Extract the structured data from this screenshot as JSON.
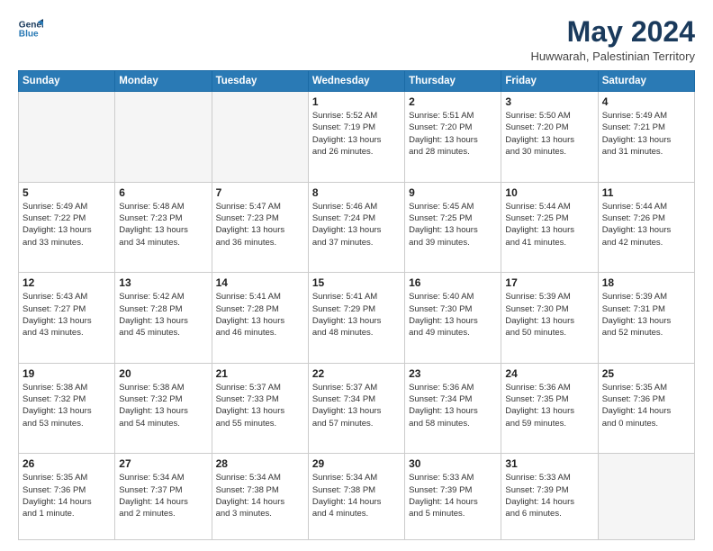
{
  "header": {
    "logo_line1": "General",
    "logo_line2": "Blue",
    "title": "May 2024",
    "subtitle": "Huwwarah, Palestinian Territory"
  },
  "weekdays": [
    "Sunday",
    "Monday",
    "Tuesday",
    "Wednesday",
    "Thursday",
    "Friday",
    "Saturday"
  ],
  "weeks": [
    [
      {
        "day": "",
        "info": ""
      },
      {
        "day": "",
        "info": ""
      },
      {
        "day": "",
        "info": ""
      },
      {
        "day": "1",
        "info": "Sunrise: 5:52 AM\nSunset: 7:19 PM\nDaylight: 13 hours\nand 26 minutes."
      },
      {
        "day": "2",
        "info": "Sunrise: 5:51 AM\nSunset: 7:20 PM\nDaylight: 13 hours\nand 28 minutes."
      },
      {
        "day": "3",
        "info": "Sunrise: 5:50 AM\nSunset: 7:20 PM\nDaylight: 13 hours\nand 30 minutes."
      },
      {
        "day": "4",
        "info": "Sunrise: 5:49 AM\nSunset: 7:21 PM\nDaylight: 13 hours\nand 31 minutes."
      }
    ],
    [
      {
        "day": "5",
        "info": "Sunrise: 5:49 AM\nSunset: 7:22 PM\nDaylight: 13 hours\nand 33 minutes."
      },
      {
        "day": "6",
        "info": "Sunrise: 5:48 AM\nSunset: 7:23 PM\nDaylight: 13 hours\nand 34 minutes."
      },
      {
        "day": "7",
        "info": "Sunrise: 5:47 AM\nSunset: 7:23 PM\nDaylight: 13 hours\nand 36 minutes."
      },
      {
        "day": "8",
        "info": "Sunrise: 5:46 AM\nSunset: 7:24 PM\nDaylight: 13 hours\nand 37 minutes."
      },
      {
        "day": "9",
        "info": "Sunrise: 5:45 AM\nSunset: 7:25 PM\nDaylight: 13 hours\nand 39 minutes."
      },
      {
        "day": "10",
        "info": "Sunrise: 5:44 AM\nSunset: 7:25 PM\nDaylight: 13 hours\nand 41 minutes."
      },
      {
        "day": "11",
        "info": "Sunrise: 5:44 AM\nSunset: 7:26 PM\nDaylight: 13 hours\nand 42 minutes."
      }
    ],
    [
      {
        "day": "12",
        "info": "Sunrise: 5:43 AM\nSunset: 7:27 PM\nDaylight: 13 hours\nand 43 minutes."
      },
      {
        "day": "13",
        "info": "Sunrise: 5:42 AM\nSunset: 7:28 PM\nDaylight: 13 hours\nand 45 minutes."
      },
      {
        "day": "14",
        "info": "Sunrise: 5:41 AM\nSunset: 7:28 PM\nDaylight: 13 hours\nand 46 minutes."
      },
      {
        "day": "15",
        "info": "Sunrise: 5:41 AM\nSunset: 7:29 PM\nDaylight: 13 hours\nand 48 minutes."
      },
      {
        "day": "16",
        "info": "Sunrise: 5:40 AM\nSunset: 7:30 PM\nDaylight: 13 hours\nand 49 minutes."
      },
      {
        "day": "17",
        "info": "Sunrise: 5:39 AM\nSunset: 7:30 PM\nDaylight: 13 hours\nand 50 minutes."
      },
      {
        "day": "18",
        "info": "Sunrise: 5:39 AM\nSunset: 7:31 PM\nDaylight: 13 hours\nand 52 minutes."
      }
    ],
    [
      {
        "day": "19",
        "info": "Sunrise: 5:38 AM\nSunset: 7:32 PM\nDaylight: 13 hours\nand 53 minutes."
      },
      {
        "day": "20",
        "info": "Sunrise: 5:38 AM\nSunset: 7:32 PM\nDaylight: 13 hours\nand 54 minutes."
      },
      {
        "day": "21",
        "info": "Sunrise: 5:37 AM\nSunset: 7:33 PM\nDaylight: 13 hours\nand 55 minutes."
      },
      {
        "day": "22",
        "info": "Sunrise: 5:37 AM\nSunset: 7:34 PM\nDaylight: 13 hours\nand 57 minutes."
      },
      {
        "day": "23",
        "info": "Sunrise: 5:36 AM\nSunset: 7:34 PM\nDaylight: 13 hours\nand 58 minutes."
      },
      {
        "day": "24",
        "info": "Sunrise: 5:36 AM\nSunset: 7:35 PM\nDaylight: 13 hours\nand 59 minutes."
      },
      {
        "day": "25",
        "info": "Sunrise: 5:35 AM\nSunset: 7:36 PM\nDaylight: 14 hours\nand 0 minutes."
      }
    ],
    [
      {
        "day": "26",
        "info": "Sunrise: 5:35 AM\nSunset: 7:36 PM\nDaylight: 14 hours\nand 1 minute."
      },
      {
        "day": "27",
        "info": "Sunrise: 5:34 AM\nSunset: 7:37 PM\nDaylight: 14 hours\nand 2 minutes."
      },
      {
        "day": "28",
        "info": "Sunrise: 5:34 AM\nSunset: 7:38 PM\nDaylight: 14 hours\nand 3 minutes."
      },
      {
        "day": "29",
        "info": "Sunrise: 5:34 AM\nSunset: 7:38 PM\nDaylight: 14 hours\nand 4 minutes."
      },
      {
        "day": "30",
        "info": "Sunrise: 5:33 AM\nSunset: 7:39 PM\nDaylight: 14 hours\nand 5 minutes."
      },
      {
        "day": "31",
        "info": "Sunrise: 5:33 AM\nSunset: 7:39 PM\nDaylight: 14 hours\nand 6 minutes."
      },
      {
        "day": "",
        "info": ""
      }
    ]
  ]
}
